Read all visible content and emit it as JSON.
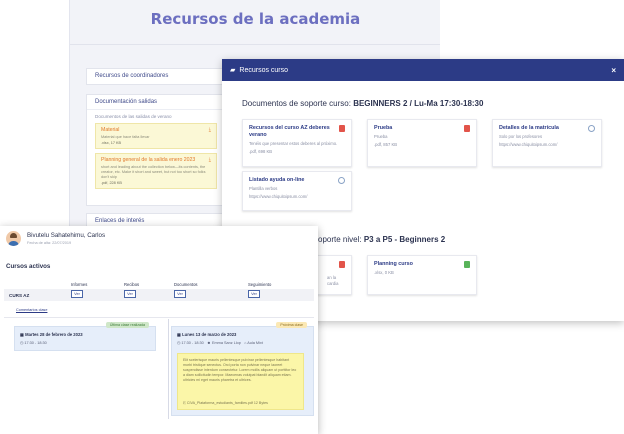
{
  "academy": {
    "title": "Recursos de la academia",
    "sections": [
      {
        "label": "Recursos de coordinadores"
      },
      {
        "label": "Documentación salidas",
        "subtitle": "Documentos de las salidas de verano"
      },
      {
        "label": "Enlaces de interés"
      }
    ],
    "files": [
      {
        "title": "Material",
        "desc": "Material que hace falta llevar",
        "meta": ".xlsx, 17 KB"
      },
      {
        "title": "Planning general de la salida enero 2023",
        "desc": "short and leading about the collection below—its contents, the creator, etc. Make it short and sweet, but not too short so folks don't skip",
        "meta": ".pdf, 228 KB"
      }
    ]
  },
  "modal": {
    "title": "Recursos curso",
    "close_symbol": "×",
    "section1_prefix": "Documentos de soporte curso:",
    "section1_course": "BEGINNERS 2 / Lu-Ma 17:30-18:30",
    "section2_prefix": "oporte nivel:",
    "section2_level": "P3 a P5 - Beginners 2",
    "cards": [
      {
        "title": "Recursos del curso AZ deberes verano",
        "desc": "Tenéis que presentar estos deberes al próximo.",
        "meta": ".pdf, 698 KB",
        "icon": "pdf-icon"
      },
      {
        "title": "Prueba",
        "desc": "Prueba",
        "meta": ".pdf, 857 KB",
        "icon": "pdf-icon"
      },
      {
        "title": "Detalles de la matrícula",
        "desc": "Solo por los profesores",
        "meta": "https://www.chiquitoipsum.com/",
        "icon": "link-icon"
      },
      {
        "title": "Listado ayuda on-line",
        "desc": "Plantilla verbos",
        "meta": "https://www.chiquitoipsum.com/",
        "icon": "link-icon"
      },
      {
        "title": "",
        "desc": "an la cardia",
        "meta": "",
        "icon": "pdf-icon"
      },
      {
        "title": "Planning curso",
        "desc": ".xlsx, 0 KB",
        "meta": "",
        "icon": "xls-icon"
      }
    ]
  },
  "student": {
    "name": "Bivutelu Sahatehimu, Carlos",
    "date": "Fecha de alta: 22/07/2019",
    "courses_title": "Cursos activos",
    "columns": [
      "Informes",
      "Recibos",
      "Documentos",
      "Seguimiento"
    ],
    "course": "CURS AZ",
    "ver_label": "Ver",
    "comments_link": "Comentarios clase",
    "last_class": {
      "tag": "Última clase realizada",
      "date": "Martes 28 de febrero de 2023",
      "time": "17:30 - 18:30"
    },
    "next_class": {
      "tag": "Próxima clase",
      "date": "Lunes 13 de marzo de 2023",
      "time": "17:30 - 18:30",
      "teacher": "Emma Sanz Llop",
      "room": "Aula Mixt"
    },
    "note": {
      "text": "Elit scelerisque mauris pellentesque pulvinar pellentesque habitant morbi tristique senectus. Orci porta non pulvinar neque laoreet suspendisse interdum consectetur. Lorem mollis aliquam ut porttitor leo a diam sollicitudin tempor. Maecenas volutpat blandit aliquam etiam. ultricies mi eget mauris pharetra et ultrices.",
      "file": "CIVA_Plataforma_estudiants_families.pdf 12 Bytes"
    }
  },
  "colors": {
    "brand": "#2c3b86",
    "title": "#6c6fc0",
    "note": "#fbf6a8"
  }
}
